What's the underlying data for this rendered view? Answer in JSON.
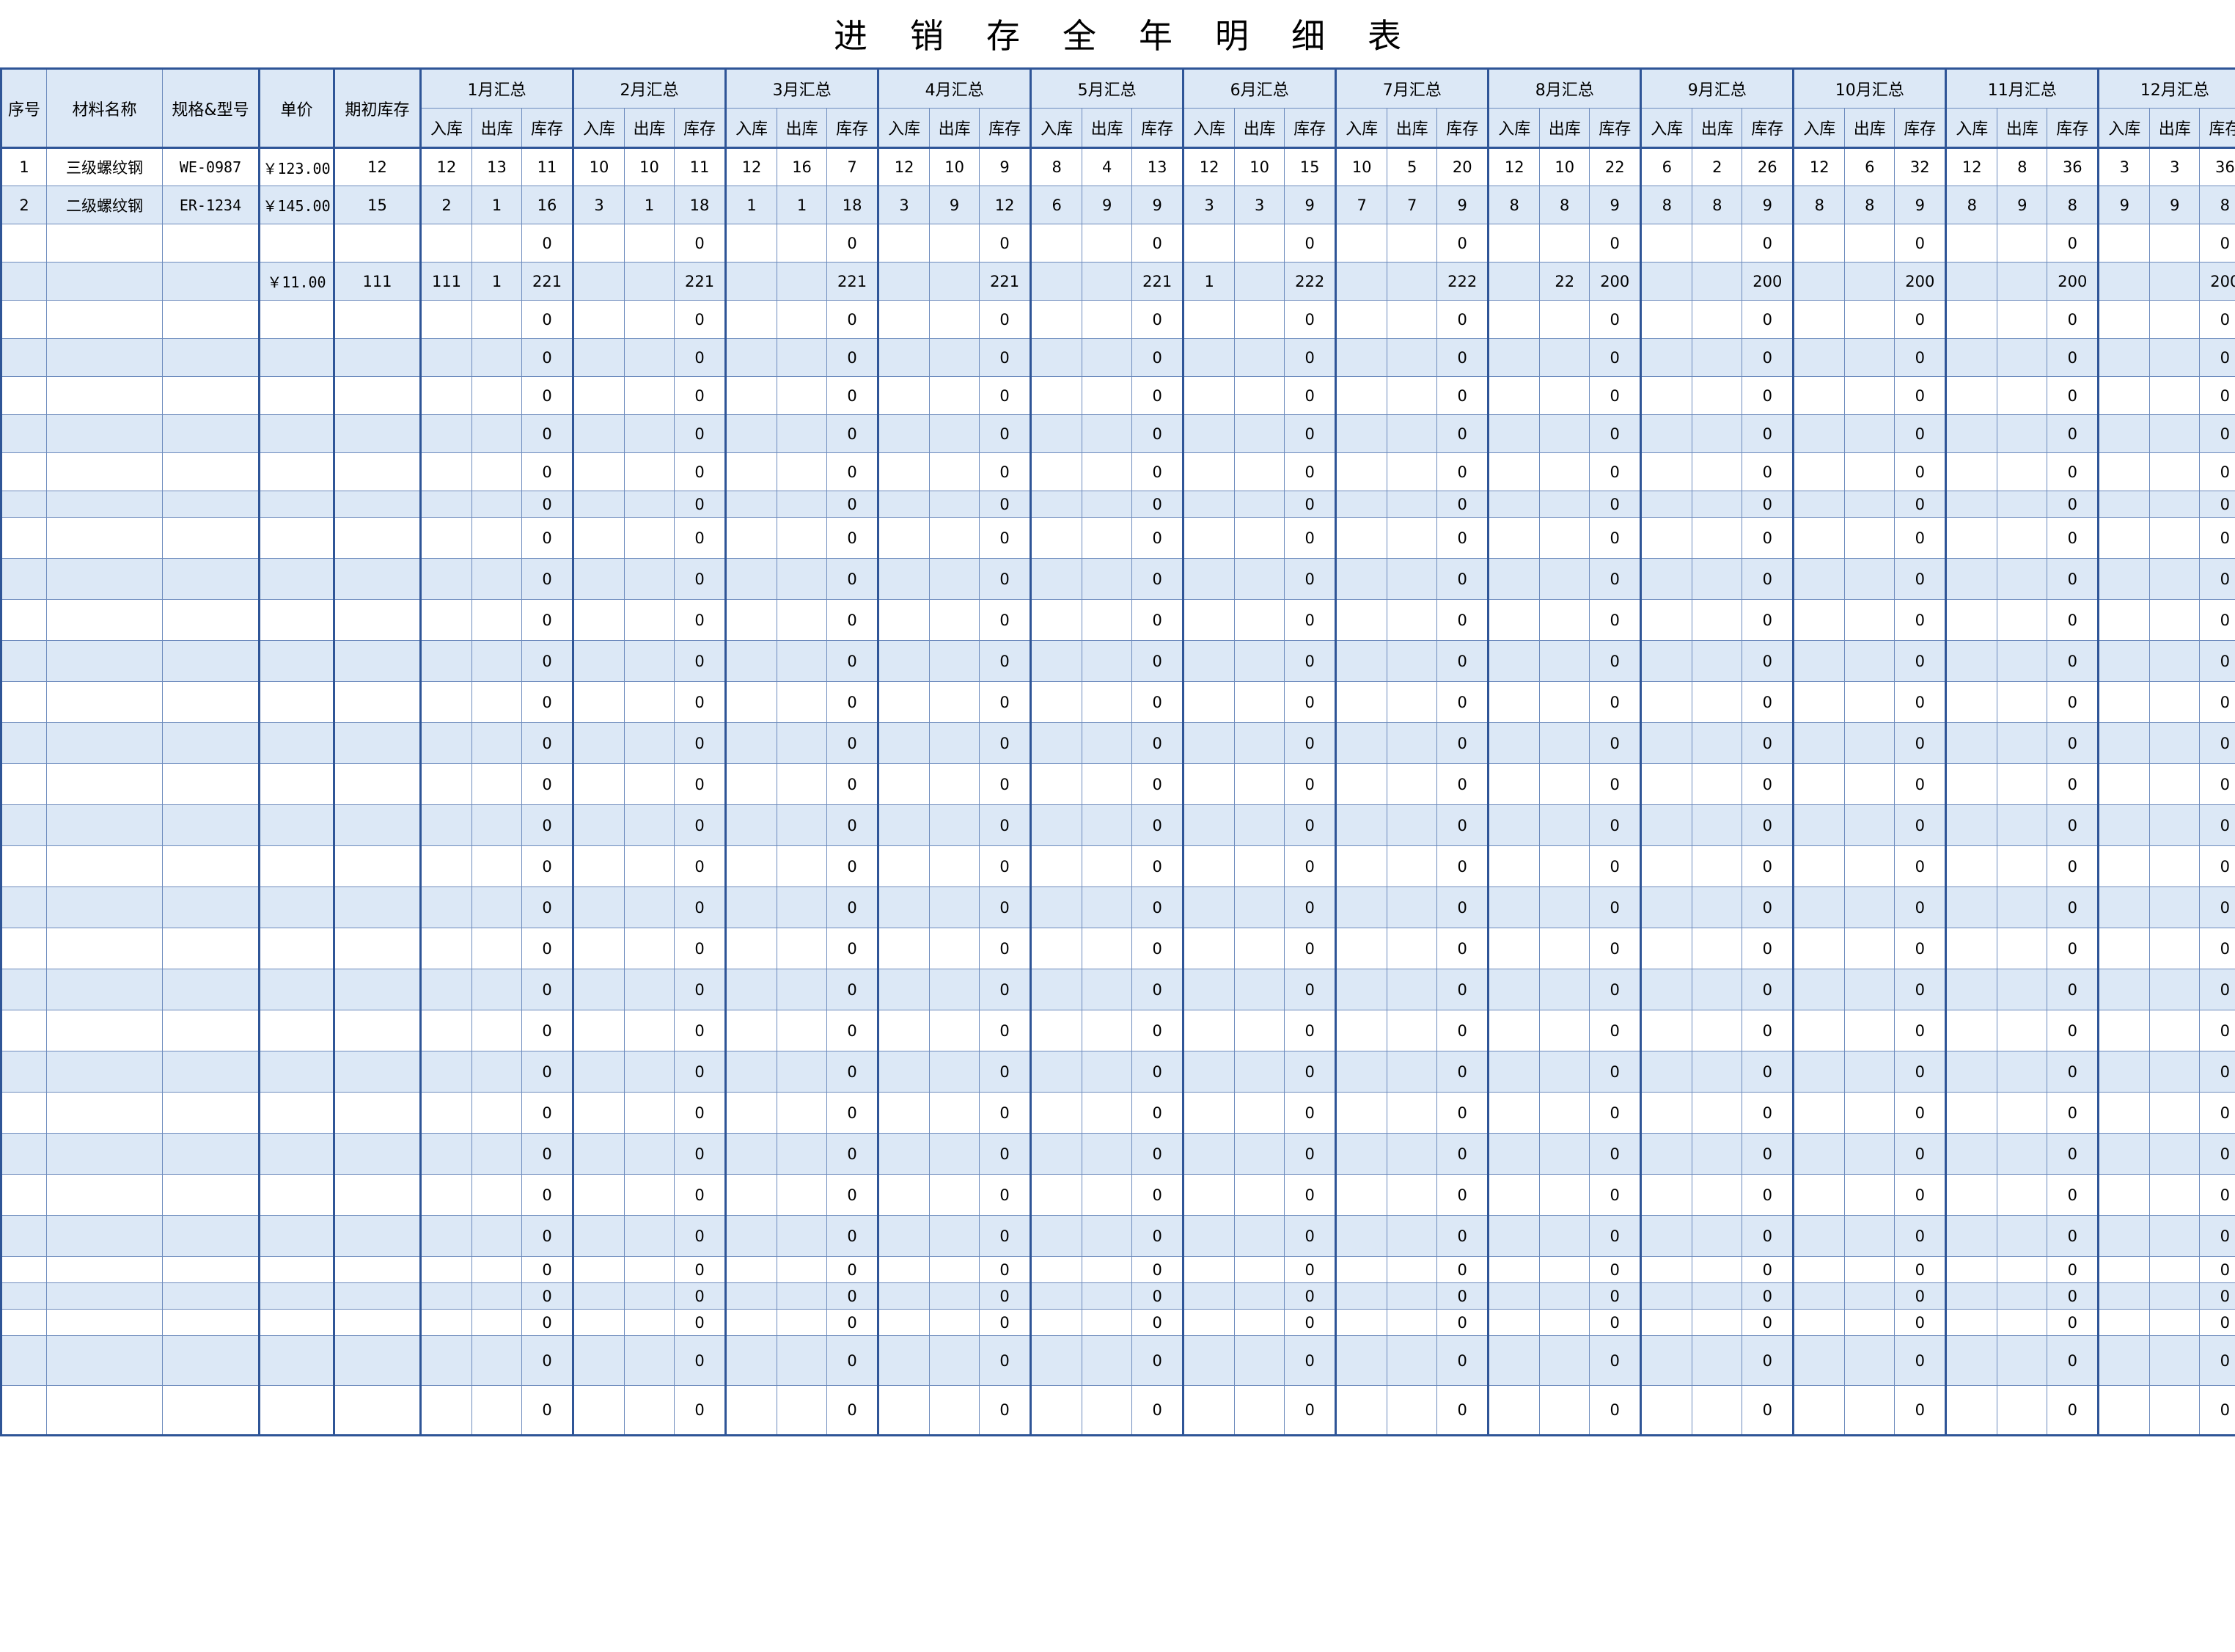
{
  "title": "进 销 存 全 年 明 细 表",
  "title_chars": [
    "进",
    "销",
    "存",
    "全",
    "年",
    "明",
    "细",
    "表"
  ],
  "headers": {
    "index": "序号",
    "name": "材料名称",
    "spec": "规格&型号",
    "price": "单价",
    "opening": "期初库存",
    "months": [
      "1月汇总",
      "2月汇总",
      "3月汇总",
      "4月汇总",
      "5月汇总",
      "6月汇总",
      "7月汇总",
      "8月汇总",
      "9月汇总",
      "10月汇总",
      "11月汇总",
      "12月汇总"
    ],
    "sub": [
      "入库",
      "出库",
      "库存"
    ]
  },
  "rows": [
    {
      "idx": "1",
      "name": "三级螺纹钢",
      "spec": "WE-0987",
      "price": "￥123.00",
      "opening": "12",
      "m": [
        [
          "12",
          "13",
          "11"
        ],
        [
          "10",
          "10",
          "11"
        ],
        [
          "12",
          "16",
          "7"
        ],
        [
          "12",
          "10",
          "9"
        ],
        [
          "8",
          "4",
          "13"
        ],
        [
          "12",
          "10",
          "15"
        ],
        [
          "10",
          "5",
          "20"
        ],
        [
          "12",
          "10",
          "22"
        ],
        [
          "6",
          "2",
          "26"
        ],
        [
          "12",
          "6",
          "32"
        ],
        [
          "12",
          "8",
          "36"
        ],
        [
          "3",
          "3",
          "36"
        ]
      ]
    },
    {
      "idx": "2",
      "name": "二级螺纹钢",
      "spec": "ER-1234",
      "price": "￥145.00",
      "opening": "15",
      "m": [
        [
          "2",
          "1",
          "16"
        ],
        [
          "3",
          "1",
          "18"
        ],
        [
          "1",
          "1",
          "18"
        ],
        [
          "3",
          "9",
          "12"
        ],
        [
          "6",
          "9",
          "9"
        ],
        [
          "3",
          "3",
          "9"
        ],
        [
          "7",
          "7",
          "9"
        ],
        [
          "8",
          "8",
          "9"
        ],
        [
          "8",
          "8",
          "9"
        ],
        [
          "8",
          "8",
          "9"
        ],
        [
          "8",
          "9",
          "8"
        ],
        [
          "9",
          "9",
          "8"
        ]
      ]
    },
    {
      "idx": "",
      "name": "",
      "spec": "",
      "price": "",
      "opening": "",
      "m": [
        [
          "",
          "",
          "0"
        ],
        [
          "",
          "",
          "0"
        ],
        [
          "",
          "",
          "0"
        ],
        [
          "",
          "",
          "0"
        ],
        [
          "",
          "",
          "0"
        ],
        [
          "",
          "",
          "0"
        ],
        [
          "",
          "",
          "0"
        ],
        [
          "",
          "",
          "0"
        ],
        [
          "",
          "",
          "0"
        ],
        [
          "",
          "",
          "0"
        ],
        [
          "",
          "",
          "0"
        ],
        [
          "",
          "",
          "0"
        ]
      ]
    },
    {
      "idx": "",
      "name": "",
      "spec": "",
      "price": "￥11.00",
      "opening": "111",
      "m": [
        [
          "111",
          "1",
          "221"
        ],
        [
          "",
          "",
          "221"
        ],
        [
          "",
          "",
          "221"
        ],
        [
          "",
          "",
          "221"
        ],
        [
          "",
          "",
          "221"
        ],
        [
          "1",
          "",
          "222"
        ],
        [
          "",
          "",
          "222"
        ],
        [
          "",
          "22",
          "200"
        ],
        [
          "",
          "",
          "200"
        ],
        [
          "",
          "",
          "200"
        ],
        [
          "",
          "",
          "200"
        ],
        [
          "",
          "",
          "200"
        ]
      ]
    }
  ],
  "empty_row_stock": "0",
  "empty_row_count": 29,
  "colors": {
    "header_bg": "#dce8f6",
    "grid": "#6d8bbd",
    "frame": "#2f5597"
  }
}
